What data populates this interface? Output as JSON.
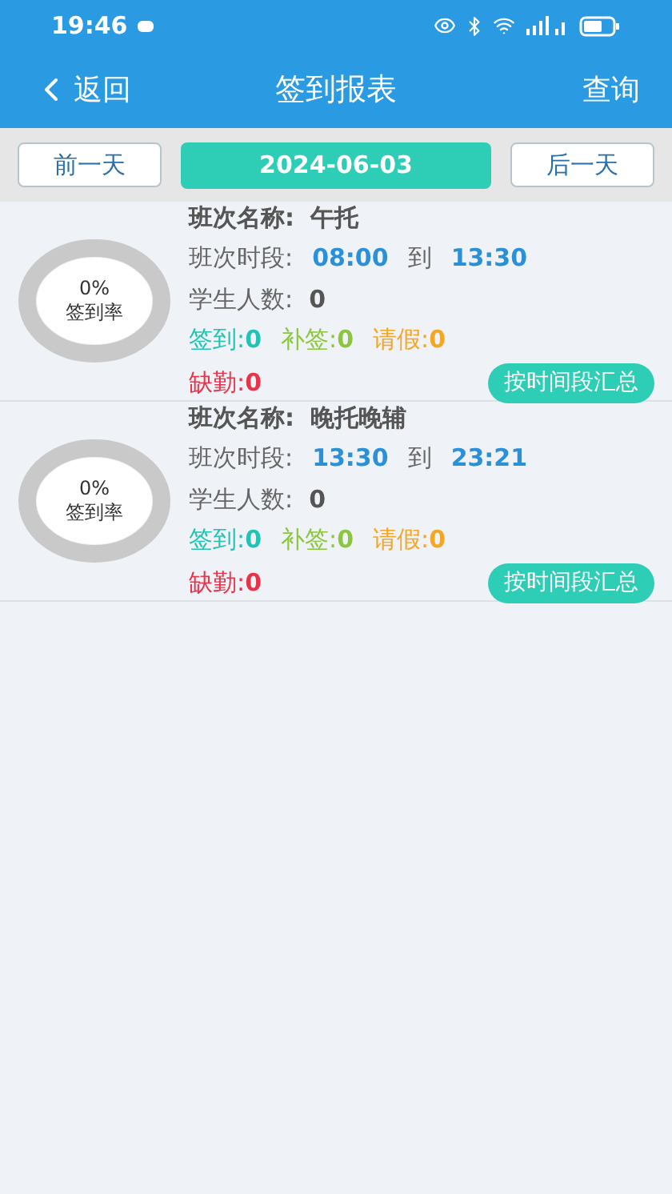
{
  "status_bar": {
    "time": "19:46"
  },
  "header": {
    "back": "返回",
    "title": "签到报表",
    "action": "查询"
  },
  "date_bar": {
    "prev": "前一天",
    "date": "2024-06-03",
    "next": "后一天"
  },
  "shifts": [
    {
      "rate": {
        "level": 0,
        "percent": "0%",
        "label": "签到率"
      },
      "name_label": "班次名称:",
      "name": "午托",
      "period_label": "班次时段:",
      "start": "08:00",
      "to": "到",
      "end": "13:30",
      "count_label": "学生人数:",
      "count": "0",
      "stats": [
        {
          "kind": "signed",
          "label": "签到:",
          "value": "0"
        },
        {
          "kind": "makeup",
          "label": "补签:",
          "value": "0"
        },
        {
          "kind": "leave",
          "label": "请假:",
          "value": "0"
        }
      ],
      "absent": {
        "kind": "absent",
        "label": "缺勤:",
        "value": "0"
      },
      "button": "按时间段汇总"
    },
    {
      "rate": {
        "level": 0,
        "percent": "0%",
        "label": "签到率"
      },
      "name_label": "班次名称:",
      "name": "晚托晚辅",
      "period_label": "班次时段:",
      "start": "13:30",
      "to": "到",
      "end": "23:21",
      "count_label": "学生人数:",
      "count": "0",
      "stats": [
        {
          "kind": "signed",
          "label": "签到:",
          "value": "0"
        },
        {
          "kind": "makeup",
          "label": "补签:",
          "value": "0"
        },
        {
          "kind": "leave",
          "label": "请假:",
          "value": "0"
        }
      ],
      "absent": {
        "kind": "absent",
        "label": "缺勤:",
        "value": "0"
      },
      "button": "按时间段汇总"
    }
  ]
}
